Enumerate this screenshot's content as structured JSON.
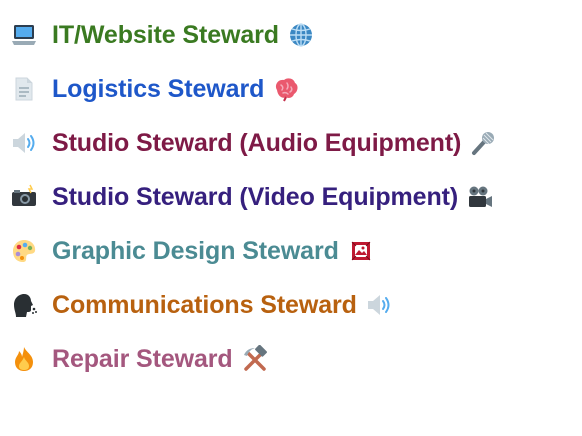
{
  "items": [
    {
      "label": "IT/Website Steward",
      "color": "#3a7a21",
      "lead_icon": "laptop-icon",
      "trail_icon": "globe-icon"
    },
    {
      "label": "Logistics Steward",
      "color": "#1e57c9",
      "lead_icon": "document-icon",
      "trail_icon": "brain-icon"
    },
    {
      "label": "Studio Steward (Audio Equipment)",
      "color": "#7e1a46",
      "lead_icon": "speaker-icon",
      "trail_icon": "microphone-icon"
    },
    {
      "label": "Studio Steward (Video Equipment)",
      "color": "#36207e",
      "lead_icon": "camera-flash-icon",
      "trail_icon": "movie-camera-icon"
    },
    {
      "label": "Graphic Design Steward",
      "color": "#4b8b93",
      "lead_icon": "artist-palette-icon",
      "trail_icon": "framed-picture-icon"
    },
    {
      "label": "Communications Steward",
      "color": "#b8610f",
      "lead_icon": "speaking-head-icon",
      "trail_icon": "speaker-icon"
    },
    {
      "label": "Repair Steward",
      "color": "#a4577e",
      "lead_icon": "fire-icon",
      "trail_icon": "hammer-pick-icon"
    }
  ]
}
